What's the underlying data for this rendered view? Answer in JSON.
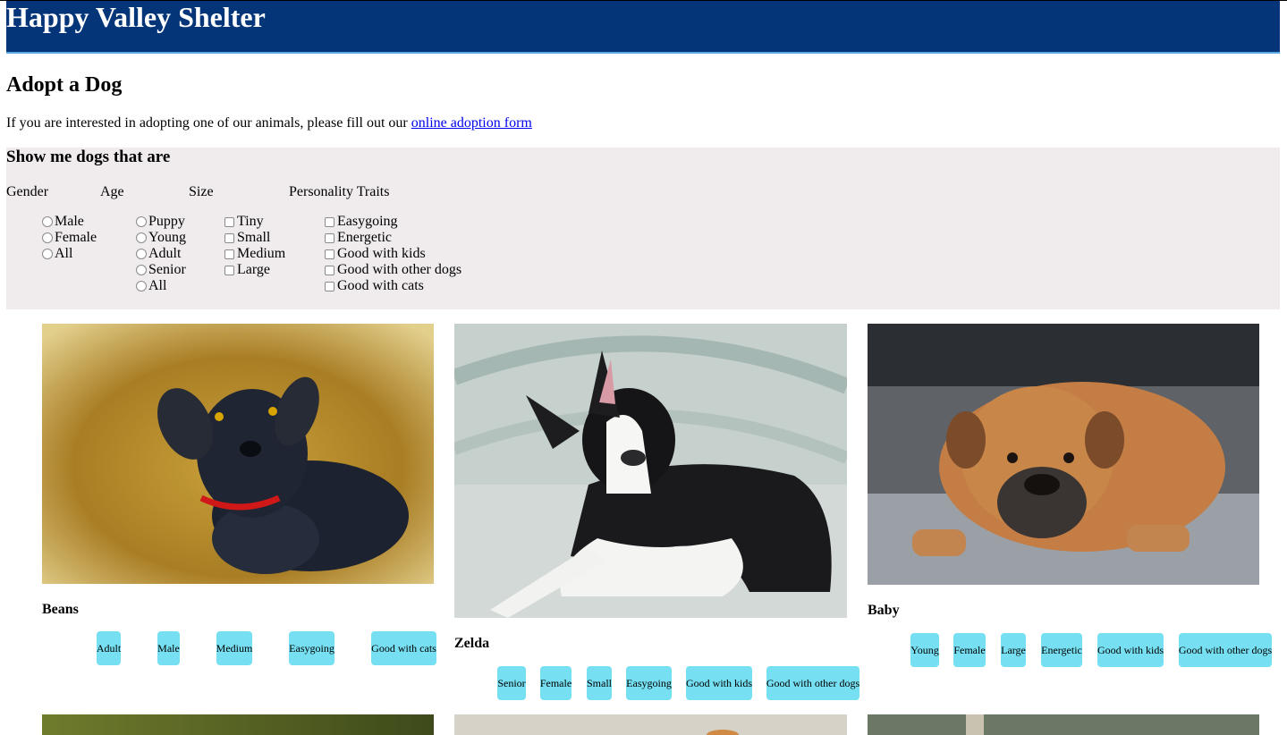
{
  "header": {
    "title": "Happy Valley Shelter"
  },
  "page": {
    "title": "Adopt a Dog",
    "intro": "If you are interested in adopting one of our animals, please fill out our",
    "link_text": "online adoption form"
  },
  "filters": {
    "heading": "Show me dogs that are",
    "gender": {
      "label": "Gender",
      "options": [
        "Male",
        "Female",
        "All"
      ]
    },
    "age": {
      "label": "Age",
      "options": [
        "Puppy",
        "Young",
        "Adult",
        "Senior",
        "All"
      ]
    },
    "size": {
      "label": "Size",
      "options": [
        "Tiny",
        "Small",
        "Medium",
        "Large"
      ]
    },
    "traits": {
      "label": "Personality Traits",
      "options": [
        "Easygoing",
        "Energetic",
        "Good with kids",
        "Good with other dogs",
        "Good with cats"
      ]
    }
  },
  "dogs": [
    {
      "name": "Beans",
      "tags": [
        "Adult",
        "Male",
        "Medium",
        "Easygoing",
        "Good with cats"
      ]
    },
    {
      "name": "Zelda",
      "tags": [
        "Senior",
        "Female",
        "Small",
        "Easygoing",
        "Good with kids",
        "Good with other dogs"
      ]
    },
    {
      "name": "Baby",
      "tags": [
        "Young",
        "Female",
        "Large",
        "Energetic",
        "Good with kids",
        "Good with other dogs"
      ]
    }
  ],
  "colors": {
    "header_bg": "#033578",
    "header_border": "#5aa9e6",
    "filter_bg": "#f0eced",
    "tag_bg": "#76e0f2",
    "link": "#0000ee"
  }
}
